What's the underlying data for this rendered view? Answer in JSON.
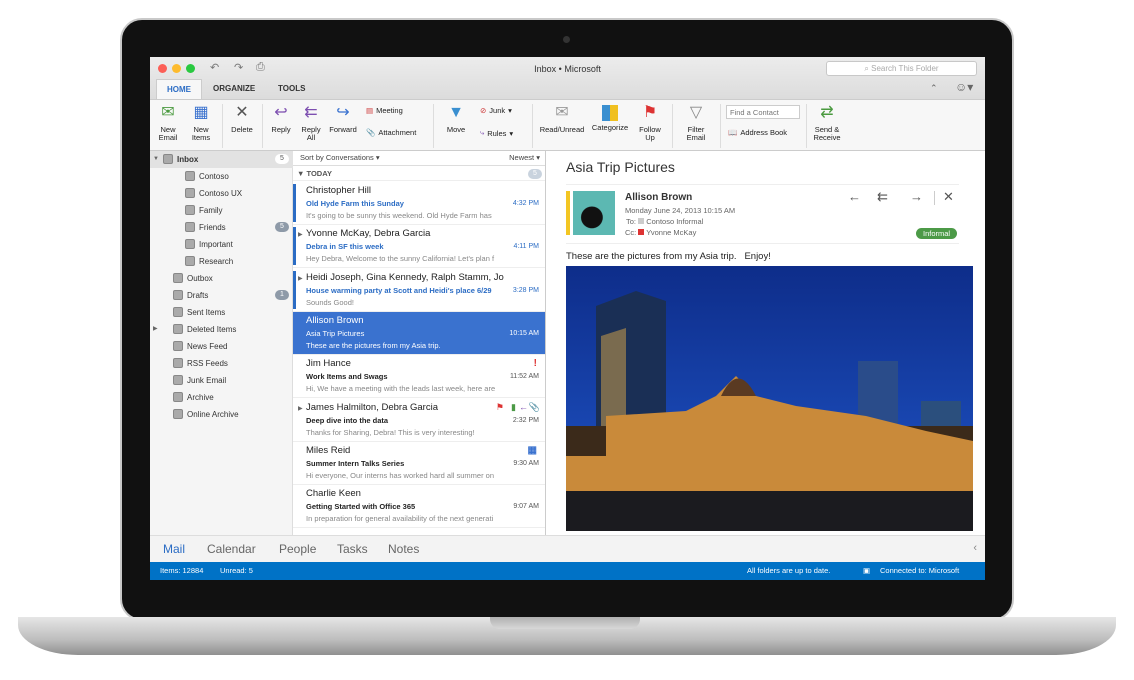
{
  "window": {
    "title": "Inbox • Microsoft",
    "search_placeholder": "Search This Folder"
  },
  "tabs": [
    {
      "label": "HOME",
      "active": true
    },
    {
      "label": "ORGANIZE"
    },
    {
      "label": "TOOLS"
    }
  ],
  "ribbon": {
    "new_email": "New Email",
    "new_items": "New Items",
    "delete": "Delete",
    "reply": "Reply",
    "reply_all": "Reply All",
    "forward": "Forward",
    "meeting": "Meeting",
    "attachment": "Attachment",
    "move": "Move",
    "junk": "Junk",
    "rules": "Rules",
    "read_unread": "Read/Unread",
    "categorize": "Categorize",
    "follow_up": "Follow Up",
    "filter_email": "Filter Email",
    "find_contact_placeholder": "Find a Contact",
    "address_book": "Address Book",
    "send_receive": "Send & Receive"
  },
  "sidebar": {
    "inbox": {
      "label": "Inbox",
      "count": "5"
    },
    "subfolders": [
      {
        "label": "Contoso"
      },
      {
        "label": "Contoso UX"
      },
      {
        "label": "Family"
      },
      {
        "label": "Friends",
        "count": "5"
      },
      {
        "label": "Important"
      },
      {
        "label": "Research"
      }
    ],
    "folders": [
      {
        "label": "Outbox",
        "icon": "outbox-icon"
      },
      {
        "label": "Drafts",
        "count": "1",
        "icon": "drafts-icon"
      },
      {
        "label": "Sent Items",
        "icon": "sent-icon"
      },
      {
        "label": "Deleted Items",
        "icon": "trash-icon"
      },
      {
        "label": "News Feed",
        "icon": "news-icon"
      },
      {
        "label": "RSS Feeds",
        "icon": "rss-icon"
      },
      {
        "label": "Junk Email",
        "icon": "junk-icon"
      },
      {
        "label": "Archive",
        "icon": "archive-icon"
      },
      {
        "label": "Online Archive",
        "icon": "online-archive-icon"
      }
    ]
  },
  "list": {
    "sort": "Sort by Conversations",
    "order": "Newest",
    "group": "TODAY",
    "group_count": "5",
    "messages": [
      {
        "from": "Christopher Hill",
        "subject": "Old Hyde Farm this Sunday",
        "time": "4:32 PM",
        "preview": "It's going to be sunny this weekend. Old Hyde Farm has",
        "unread": true
      },
      {
        "from": "Yvonne McKay, Debra Garcia",
        "subject": "Debra in SF this week",
        "time": "4:11 PM",
        "preview": "Hey Debra, Welcome to the sunny California! Let's plan f",
        "unread": true,
        "thread": true
      },
      {
        "from": "Heidi Joseph, Gina Kennedy, Ralph Stamm, Jo",
        "subject": "House warming party at Scott and Heidi's place 6/29",
        "time": "3:28 PM",
        "preview": "Sounds Good!",
        "unread": true,
        "thread": true
      },
      {
        "from": "Allison Brown",
        "subject": "Asia Trip Pictures",
        "time": "10:15 AM",
        "preview": "These are the pictures from my Asia trip.",
        "selected": true
      },
      {
        "from": "Jim Hance",
        "subject": "Work Items and Swags",
        "time": "11:52 AM",
        "preview": "Hi, We have a meeting with the leads last week, here are",
        "icon": "important-icon"
      },
      {
        "from": "James Halmilton, Debra Garcia",
        "subject": "Deep dive into the data",
        "time": "2:32 PM",
        "preview": "Thanks for Sharing, Debra! This is very interesting!",
        "thread": true
      },
      {
        "from": "Miles Reid",
        "subject": "Summer Intern Talks Series",
        "time": "9:30 AM",
        "preview": "Hi everyone, Our interns has worked hard all summer on",
        "icon": "meeting-icon"
      },
      {
        "from": "Charlie Keen",
        "subject": "Getting Started with Office 365",
        "time": "9:07 AM",
        "preview": "In preparation for general availability of the next generati"
      }
    ]
  },
  "reading": {
    "title": "Asia Trip Pictures",
    "sender": "Allison Brown",
    "date": "Monday June 24, 2013 10:15 AM",
    "to_label": "To:",
    "to": "Contoso Informal",
    "cc_label": "Cc:",
    "cc": "Yvonne McKay",
    "category": "Informal",
    "body": "These are the pictures from my Asia trip.   Enjoy!"
  },
  "nav": [
    "Mail",
    "Calendar",
    "People",
    "Tasks",
    "Notes"
  ],
  "status": {
    "items": "Items: 12884",
    "unread": "Unread: 5",
    "sync": "All folders are up to date.",
    "connection": "Connected to: Microsoft"
  },
  "colors": {
    "accent": "#2b6cc4",
    "status_bar": "#0072c6",
    "selected": "#3a72cf",
    "informal": "#4c9a47"
  }
}
